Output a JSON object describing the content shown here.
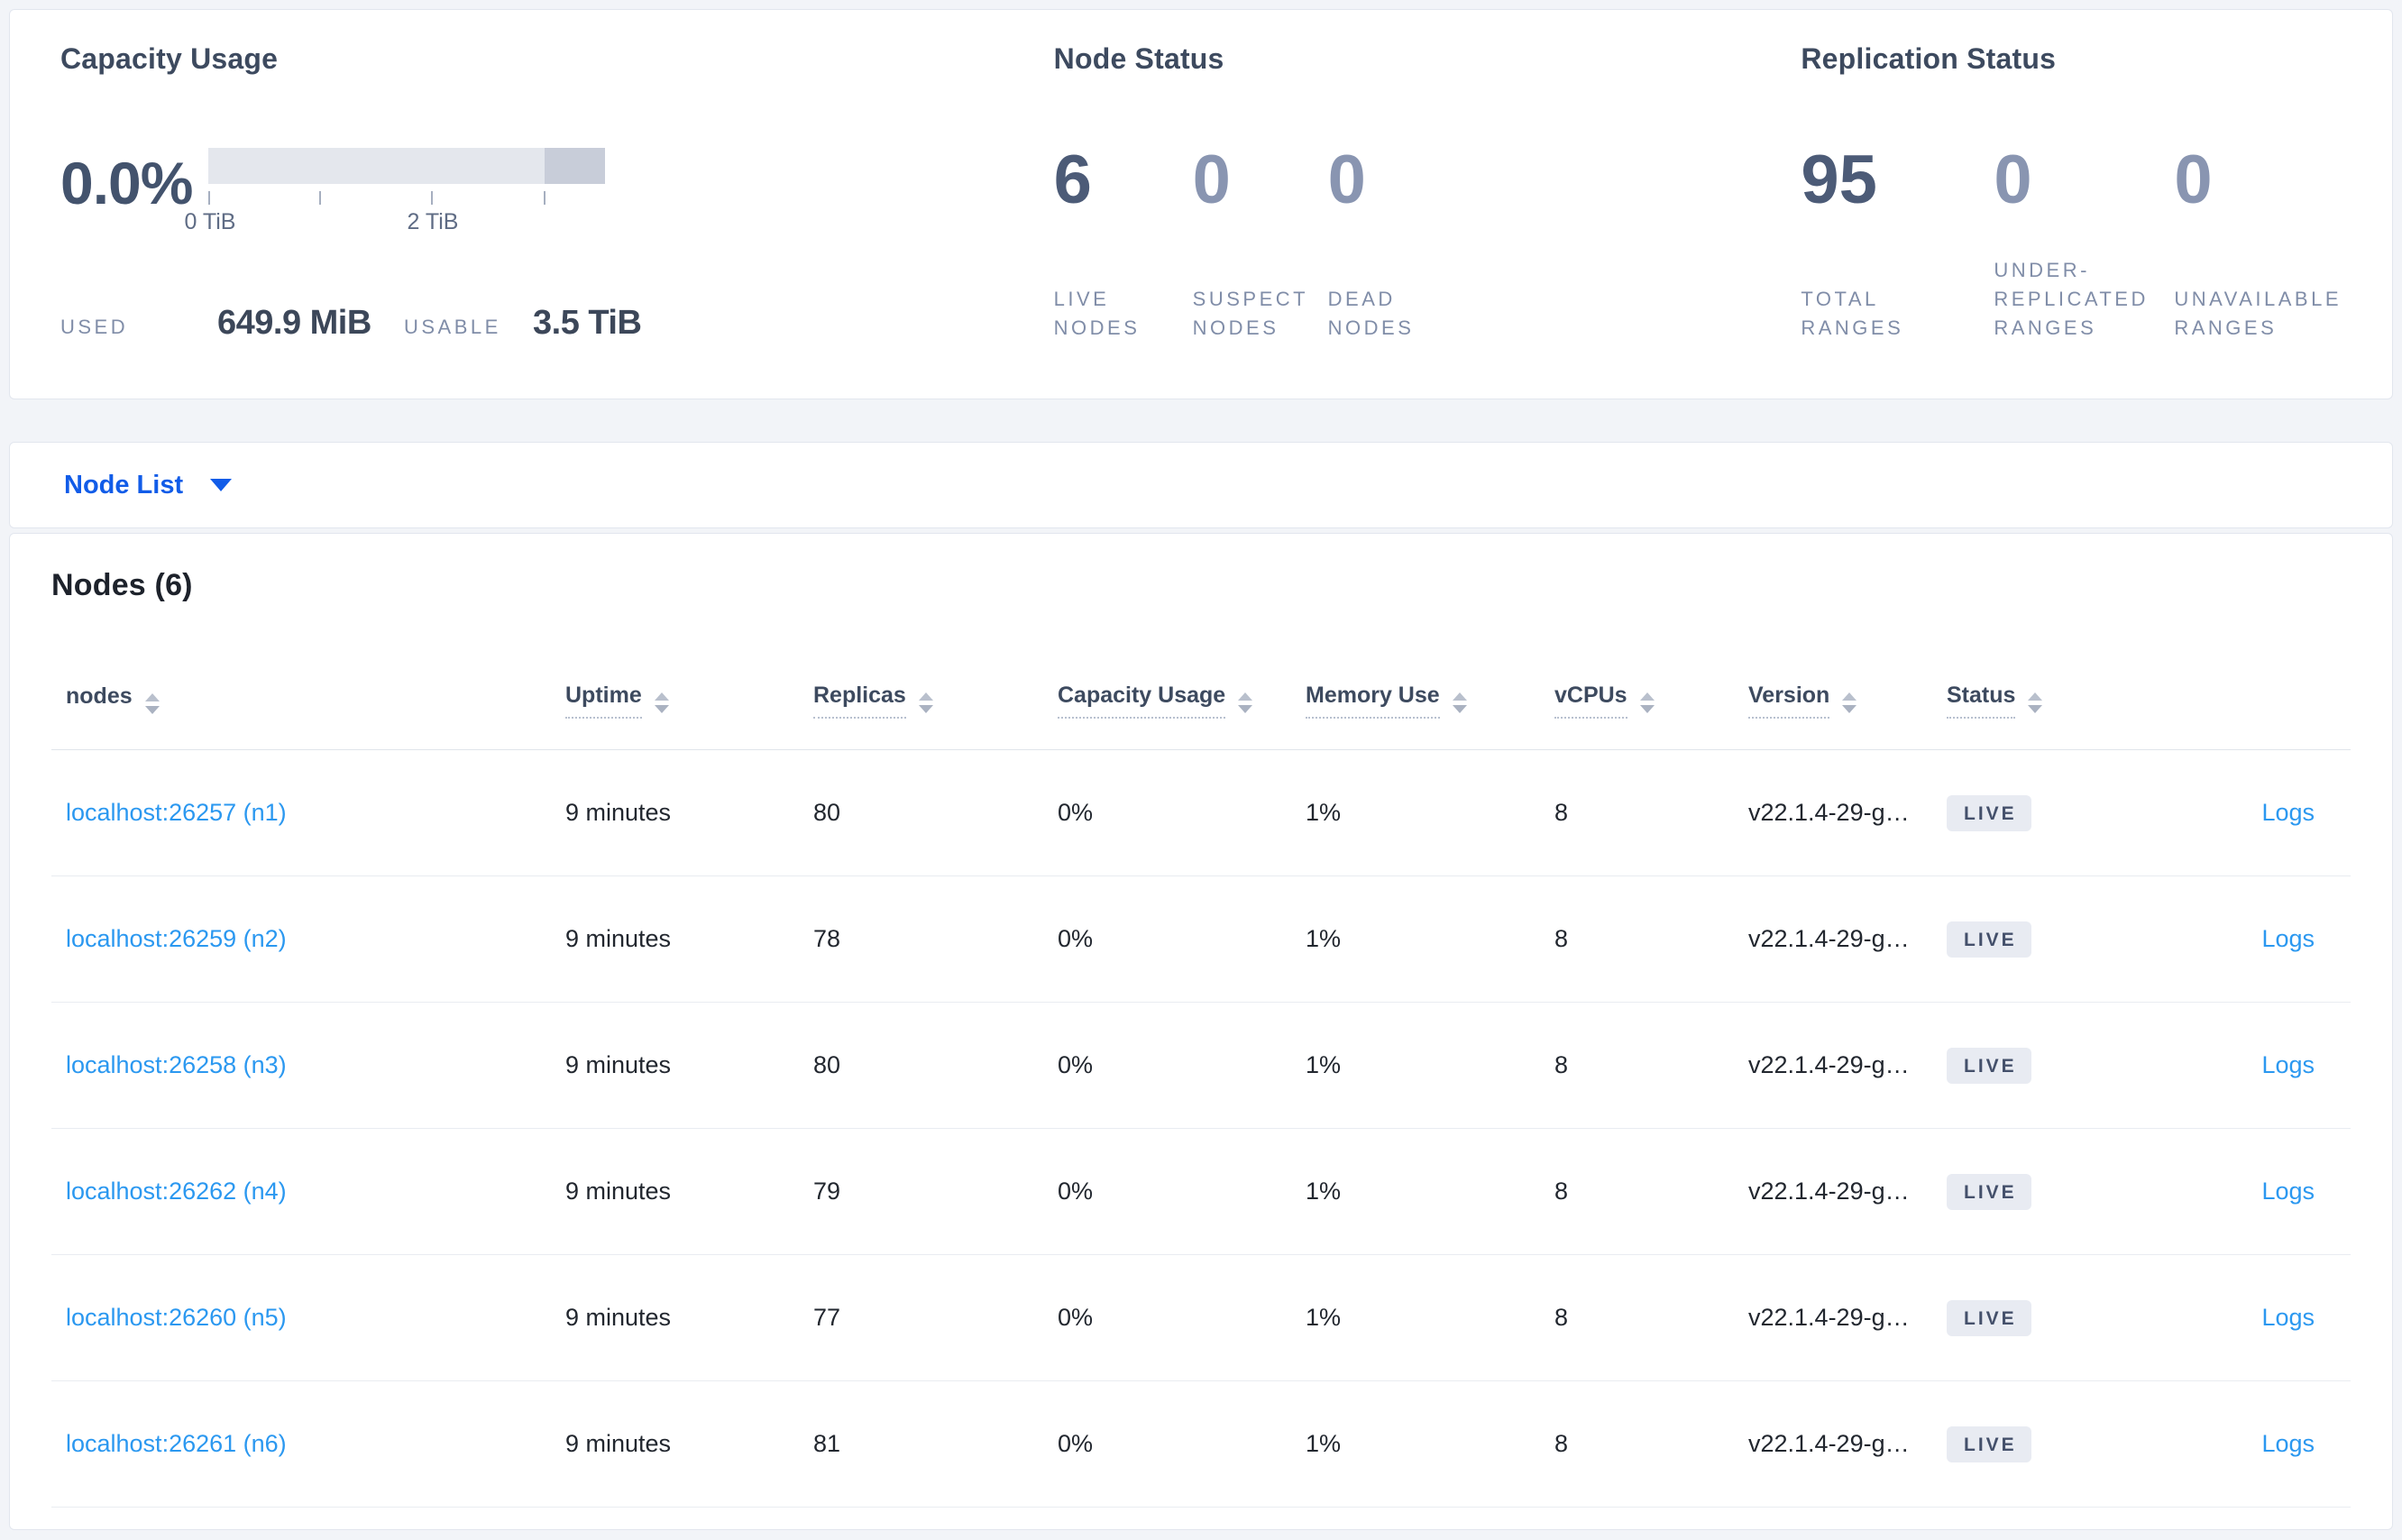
{
  "colors": {
    "page_background": "#f2f4f8",
    "card_background": "#ffffff",
    "accent_blue": "#115ce8",
    "link_blue": "#2b98f0",
    "heading_slate": "#3d4a5f",
    "value_primary": "#4c5b77",
    "value_muted": "#8995b1",
    "kicker_gray": "#808da8",
    "bar_light": "#e4e7ed",
    "bar_dark": "#c8cdd9",
    "badge_background": "#e8ebf2",
    "badge_text": "#44506b"
  },
  "summary": {
    "capacity": {
      "title": "Capacity Usage",
      "percent": "0.0%",
      "tick_labels": [
        "0 TiB",
        "2 TiB"
      ],
      "used_label": "USED",
      "used_value": "649.9 MiB",
      "usable_label": "USABLE",
      "usable_value": "3.5 TiB"
    },
    "node_status": {
      "title": "Node Status",
      "metrics": [
        {
          "value": "6",
          "label": "LIVE\nNODES"
        },
        {
          "value": "0",
          "label": "SUSPECT\nNODES"
        },
        {
          "value": "0",
          "label": "DEAD\nNODES"
        }
      ]
    },
    "replication_status": {
      "title": "Replication Status",
      "metrics": [
        {
          "value": "95",
          "label": "TOTAL\nRANGES"
        },
        {
          "value": "0",
          "label": "UNDER-\nREPLICATED\nRANGES"
        },
        {
          "value": "0",
          "label": "UNAVAILABLE\nRANGES"
        }
      ]
    }
  },
  "node_list_selector": {
    "label": "Node List"
  },
  "table": {
    "title": "Nodes (6)",
    "columns": [
      {
        "label": "nodes"
      },
      {
        "label": "Uptime"
      },
      {
        "label": "Replicas"
      },
      {
        "label": "Capacity Usage"
      },
      {
        "label": "Memory Use"
      },
      {
        "label": "vCPUs"
      },
      {
        "label": "Version"
      },
      {
        "label": "Status"
      }
    ],
    "rows": [
      {
        "node": "localhost:26257 (n1)",
        "uptime": "9 minutes",
        "replicas": "80",
        "capacity_usage": "0%",
        "memory_use": "1%",
        "vcpus": "8",
        "version": "v22.1.4-29-g…",
        "status": "LIVE",
        "logs": "Logs"
      },
      {
        "node": "localhost:26259 (n2)",
        "uptime": "9 minutes",
        "replicas": "78",
        "capacity_usage": "0%",
        "memory_use": "1%",
        "vcpus": "8",
        "version": "v22.1.4-29-g…",
        "status": "LIVE",
        "logs": "Logs"
      },
      {
        "node": "localhost:26258 (n3)",
        "uptime": "9 minutes",
        "replicas": "80",
        "capacity_usage": "0%",
        "memory_use": "1%",
        "vcpus": "8",
        "version": "v22.1.4-29-g…",
        "status": "LIVE",
        "logs": "Logs"
      },
      {
        "node": "localhost:26262 (n4)",
        "uptime": "9 minutes",
        "replicas": "79",
        "capacity_usage": "0%",
        "memory_use": "1%",
        "vcpus": "8",
        "version": "v22.1.4-29-g…",
        "status": "LIVE",
        "logs": "Logs"
      },
      {
        "node": "localhost:26260 (n5)",
        "uptime": "9 minutes",
        "replicas": "77",
        "capacity_usage": "0%",
        "memory_use": "1%",
        "vcpus": "8",
        "version": "v22.1.4-29-g…",
        "status": "LIVE",
        "logs": "Logs"
      },
      {
        "node": "localhost:26261 (n6)",
        "uptime": "9 minutes",
        "replicas": "81",
        "capacity_usage": "0%",
        "memory_use": "1%",
        "vcpus": "8",
        "version": "v22.1.4-29-g…",
        "status": "LIVE",
        "logs": "Logs"
      }
    ]
  }
}
